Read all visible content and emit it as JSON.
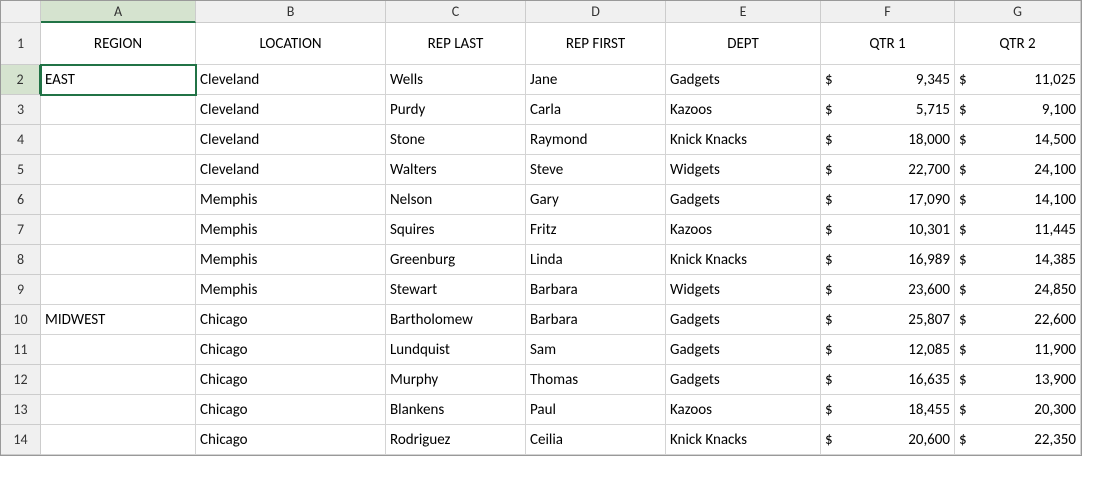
{
  "columns": [
    "A",
    "B",
    "C",
    "D",
    "E",
    "F",
    "G"
  ],
  "selected_cell": "A2",
  "headers": {
    "A": "REGION",
    "B": "LOCATION",
    "C": "REP LAST",
    "D": "REP FIRST",
    "E": "DEPT",
    "F": "QTR 1",
    "G": "QTR 2"
  },
  "row_numbers": [
    "1",
    "2",
    "3",
    "4",
    "5",
    "6",
    "7",
    "8",
    "9",
    "10",
    "11",
    "12",
    "13",
    "14"
  ],
  "rows": [
    {
      "region": "EAST",
      "location": "Cleveland",
      "last": "Wells",
      "first": "Jane",
      "dept": "Gadgets",
      "q1": "9,345",
      "q2": "11,025"
    },
    {
      "region": "",
      "location": "Cleveland",
      "last": "Purdy",
      "first": "Carla",
      "dept": "Kazoos",
      "q1": "5,715",
      "q2": "9,100"
    },
    {
      "region": "",
      "location": "Cleveland",
      "last": "Stone",
      "first": "Raymond",
      "dept": "Knick Knacks",
      "q1": "18,000",
      "q2": "14,500"
    },
    {
      "region": "",
      "location": "Cleveland",
      "last": "Walters",
      "first": "Steve",
      "dept": "Widgets",
      "q1": "22,700",
      "q2": "24,100"
    },
    {
      "region": "",
      "location": "Memphis",
      "last": "Nelson",
      "first": "Gary",
      "dept": "Gadgets",
      "q1": "17,090",
      "q2": "14,100"
    },
    {
      "region": "",
      "location": "Memphis",
      "last": "Squires",
      "first": "Fritz",
      "dept": "Kazoos",
      "q1": "10,301",
      "q2": "11,445"
    },
    {
      "region": "",
      "location": "Memphis",
      "last": "Greenburg",
      "first": "Linda",
      "dept": "Knick Knacks",
      "q1": "16,989",
      "q2": "14,385"
    },
    {
      "region": "",
      "location": "Memphis",
      "last": "Stewart",
      "first": "Barbara",
      "dept": "Widgets",
      "q1": "23,600",
      "q2": "24,850"
    },
    {
      "region": "MIDWEST",
      "location": "Chicago",
      "last": "Bartholomew",
      "first": "Barbara",
      "dept": "Gadgets",
      "q1": "25,807",
      "q2": "22,600"
    },
    {
      "region": "",
      "location": "Chicago",
      "last": "Lundquist",
      "first": "Sam",
      "dept": "Gadgets",
      "q1": "12,085",
      "q2": "11,900"
    },
    {
      "region": "",
      "location": "Chicago",
      "last": "Murphy",
      "first": "Thomas",
      "dept": "Gadgets",
      "q1": "16,635",
      "q2": "13,900"
    },
    {
      "region": "",
      "location": "Chicago",
      "last": "Blankens",
      "first": "Paul",
      "dept": "Kazoos",
      "q1": "18,455",
      "q2": "20,300"
    },
    {
      "region": "",
      "location": "Chicago",
      "last": "Rodriguez",
      "first": "Ceilia",
      "dept": "Knick Knacks",
      "q1": "20,600",
      "q2": "22,350"
    }
  ],
  "currency": "$",
  "chart_data": {
    "type": "table",
    "title": "",
    "columns": [
      "REGION",
      "LOCATION",
      "REP LAST",
      "REP FIRST",
      "DEPT",
      "QTR 1",
      "QTR 2"
    ],
    "data": [
      [
        "EAST",
        "Cleveland",
        "Wells",
        "Jane",
        "Gadgets",
        9345,
        11025
      ],
      [
        "EAST",
        "Cleveland",
        "Purdy",
        "Carla",
        "Kazoos",
        5715,
        9100
      ],
      [
        "EAST",
        "Cleveland",
        "Stone",
        "Raymond",
        "Knick Knacks",
        18000,
        14500
      ],
      [
        "EAST",
        "Cleveland",
        "Walters",
        "Steve",
        "Widgets",
        22700,
        24100
      ],
      [
        "EAST",
        "Memphis",
        "Nelson",
        "Gary",
        "Gadgets",
        17090,
        14100
      ],
      [
        "EAST",
        "Memphis",
        "Squires",
        "Fritz",
        "Kazoos",
        10301,
        11445
      ],
      [
        "EAST",
        "Memphis",
        "Greenburg",
        "Linda",
        "Knick Knacks",
        16989,
        14385
      ],
      [
        "EAST",
        "Memphis",
        "Stewart",
        "Barbara",
        "Widgets",
        23600,
        24850
      ],
      [
        "MIDWEST",
        "Chicago",
        "Bartholomew",
        "Barbara",
        "Gadgets",
        25807,
        22600
      ],
      [
        "MIDWEST",
        "Chicago",
        "Lundquist",
        "Sam",
        "Gadgets",
        12085,
        11900
      ],
      [
        "MIDWEST",
        "Chicago",
        "Murphy",
        "Thomas",
        "Gadgets",
        16635,
        13900
      ],
      [
        "MIDWEST",
        "Chicago",
        "Blankens",
        "Paul",
        "Kazoos",
        18455,
        20300
      ],
      [
        "MIDWEST",
        "Chicago",
        "Rodriguez",
        "Ceilia",
        "Knick Knacks",
        20600,
        22350
      ]
    ]
  }
}
